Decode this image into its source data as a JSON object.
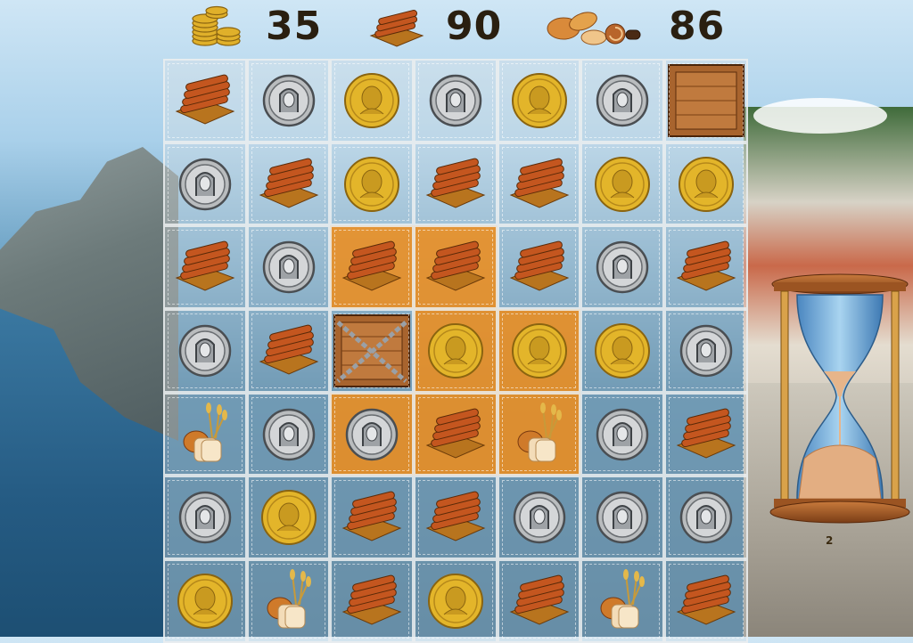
{
  "hud": {
    "gold": {
      "icon": "gold-coins-stack-icon",
      "value": "35"
    },
    "wood": {
      "icon": "wood-planks-icon",
      "value": "90"
    },
    "food": {
      "icon": "bread-pastries-icon",
      "value": "86"
    }
  },
  "board": {
    "rows": [
      [
        {
          "t": "wood",
          "lit": false
        },
        {
          "t": "silver",
          "lit": false
        },
        {
          "t": "gold",
          "lit": false
        },
        {
          "t": "silver",
          "lit": false
        },
        {
          "t": "gold",
          "lit": false
        },
        {
          "t": "silver",
          "lit": false
        },
        {
          "t": "crate",
          "lit": false
        }
      ],
      [
        {
          "t": "silver",
          "lit": false
        },
        {
          "t": "wood",
          "lit": false
        },
        {
          "t": "gold",
          "lit": false
        },
        {
          "t": "wood",
          "lit": false
        },
        {
          "t": "wood",
          "lit": false
        },
        {
          "t": "gold",
          "lit": false
        },
        {
          "t": "gold",
          "lit": false
        }
      ],
      [
        {
          "t": "wood",
          "lit": false
        },
        {
          "t": "silver",
          "lit": false
        },
        {
          "t": "wood",
          "lit": true
        },
        {
          "t": "wood",
          "lit": true
        },
        {
          "t": "wood",
          "lit": false
        },
        {
          "t": "silver",
          "lit": false
        },
        {
          "t": "wood",
          "lit": false
        }
      ],
      [
        {
          "t": "silver",
          "lit": false
        },
        {
          "t": "wood",
          "lit": false
        },
        {
          "t": "chained-crate",
          "lit": false
        },
        {
          "t": "gold",
          "lit": true
        },
        {
          "t": "gold",
          "lit": true
        },
        {
          "t": "gold",
          "lit": false
        },
        {
          "t": "silver",
          "lit": false
        }
      ],
      [
        {
          "t": "bread",
          "lit": false
        },
        {
          "t": "silver",
          "lit": false
        },
        {
          "t": "silver",
          "lit": true
        },
        {
          "t": "wood",
          "lit": true
        },
        {
          "t": "bread",
          "lit": true
        },
        {
          "t": "silver",
          "lit": false
        },
        {
          "t": "wood",
          "lit": false
        }
      ],
      [
        {
          "t": "silver",
          "lit": false
        },
        {
          "t": "gold",
          "lit": false
        },
        {
          "t": "wood",
          "lit": false
        },
        {
          "t": "wood",
          "lit": false
        },
        {
          "t": "silver",
          "lit": false
        },
        {
          "t": "silver",
          "lit": false
        },
        {
          "t": "silver",
          "lit": false
        }
      ],
      [
        {
          "t": "gold",
          "lit": false
        },
        {
          "t": "bread",
          "lit": false
        },
        {
          "t": "wood",
          "lit": false
        },
        {
          "t": "gold",
          "lit": false
        },
        {
          "t": "wood",
          "lit": false
        },
        {
          "t": "bread",
          "lit": false
        },
        {
          "t": "wood",
          "lit": false
        }
      ]
    ]
  },
  "timer": {
    "icon": "hourglass-icon",
    "label": "2",
    "sand_remaining_fraction": 0.35
  },
  "colors": {
    "highlight": "#ec9128",
    "gold": "#e3b52a",
    "silver": "#b9bcbe",
    "wood": "#c45a22"
  }
}
